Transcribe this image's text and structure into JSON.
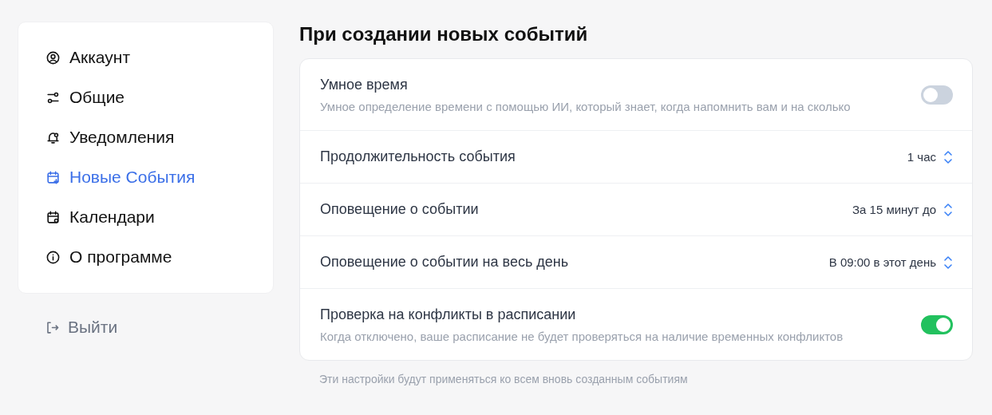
{
  "sidebar": {
    "items": [
      {
        "label": "Аккаунт",
        "selected": false
      },
      {
        "label": "Общие",
        "selected": false
      },
      {
        "label": "Уведомления",
        "selected": false
      },
      {
        "label": "Новые События",
        "selected": true
      },
      {
        "label": "Календари",
        "selected": false
      },
      {
        "label": "О программе",
        "selected": false
      }
    ],
    "logout": "Выйти"
  },
  "section": {
    "title": "При создании новых событий",
    "rows": [
      {
        "kind": "toggle",
        "label": "Умное время",
        "description": "Умное определение времени с помощью ИИ, который знает, когда напомнить вам и на сколько",
        "on": false
      },
      {
        "kind": "select",
        "label": "Продолжительность события",
        "value": "1 час"
      },
      {
        "kind": "select",
        "label": "Оповещение о событии",
        "value": "За 15 минут до"
      },
      {
        "kind": "select",
        "label": "Оповещение о событии на весь день",
        "value": "В 09:00 в этот день"
      },
      {
        "kind": "toggle",
        "label": "Проверка на конфликты в расписании",
        "description": "Когда отключено, ваше расписание не будет проверяться на наличие временных конфликтов",
        "on": true
      }
    ],
    "footnote": "Эти настройки будут применяться ко всем вновь созданным событиям"
  }
}
